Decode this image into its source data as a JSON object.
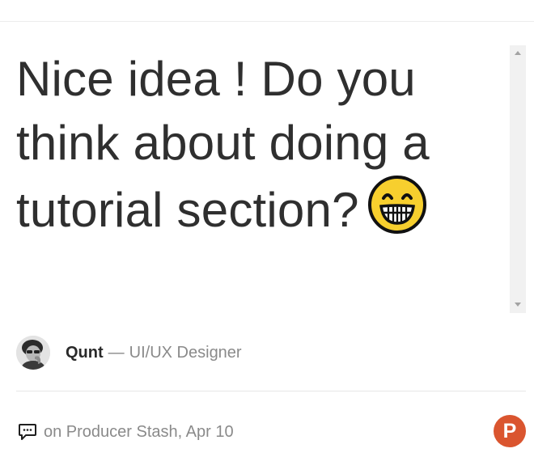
{
  "comment": {
    "text": "Nice idea ! Do you think about doing a tutorial section?",
    "emoji": "grinning-face-emoji"
  },
  "author": {
    "name": "Qunt",
    "separator": "—",
    "role": "UI/UX Designer"
  },
  "meta": {
    "text": "on Producer Stash, Apr 10",
    "icon": "comment-icon"
  },
  "brand": {
    "logo_letter": "P",
    "logo_name": "product-hunt-logo",
    "accent": "#da552f"
  },
  "colors": {
    "text_primary": "#2f2f2f",
    "text_secondary": "#8a8a8a",
    "scrollbar_track": "#f1f1f1",
    "emoji_fill": "#f7cf2e"
  }
}
